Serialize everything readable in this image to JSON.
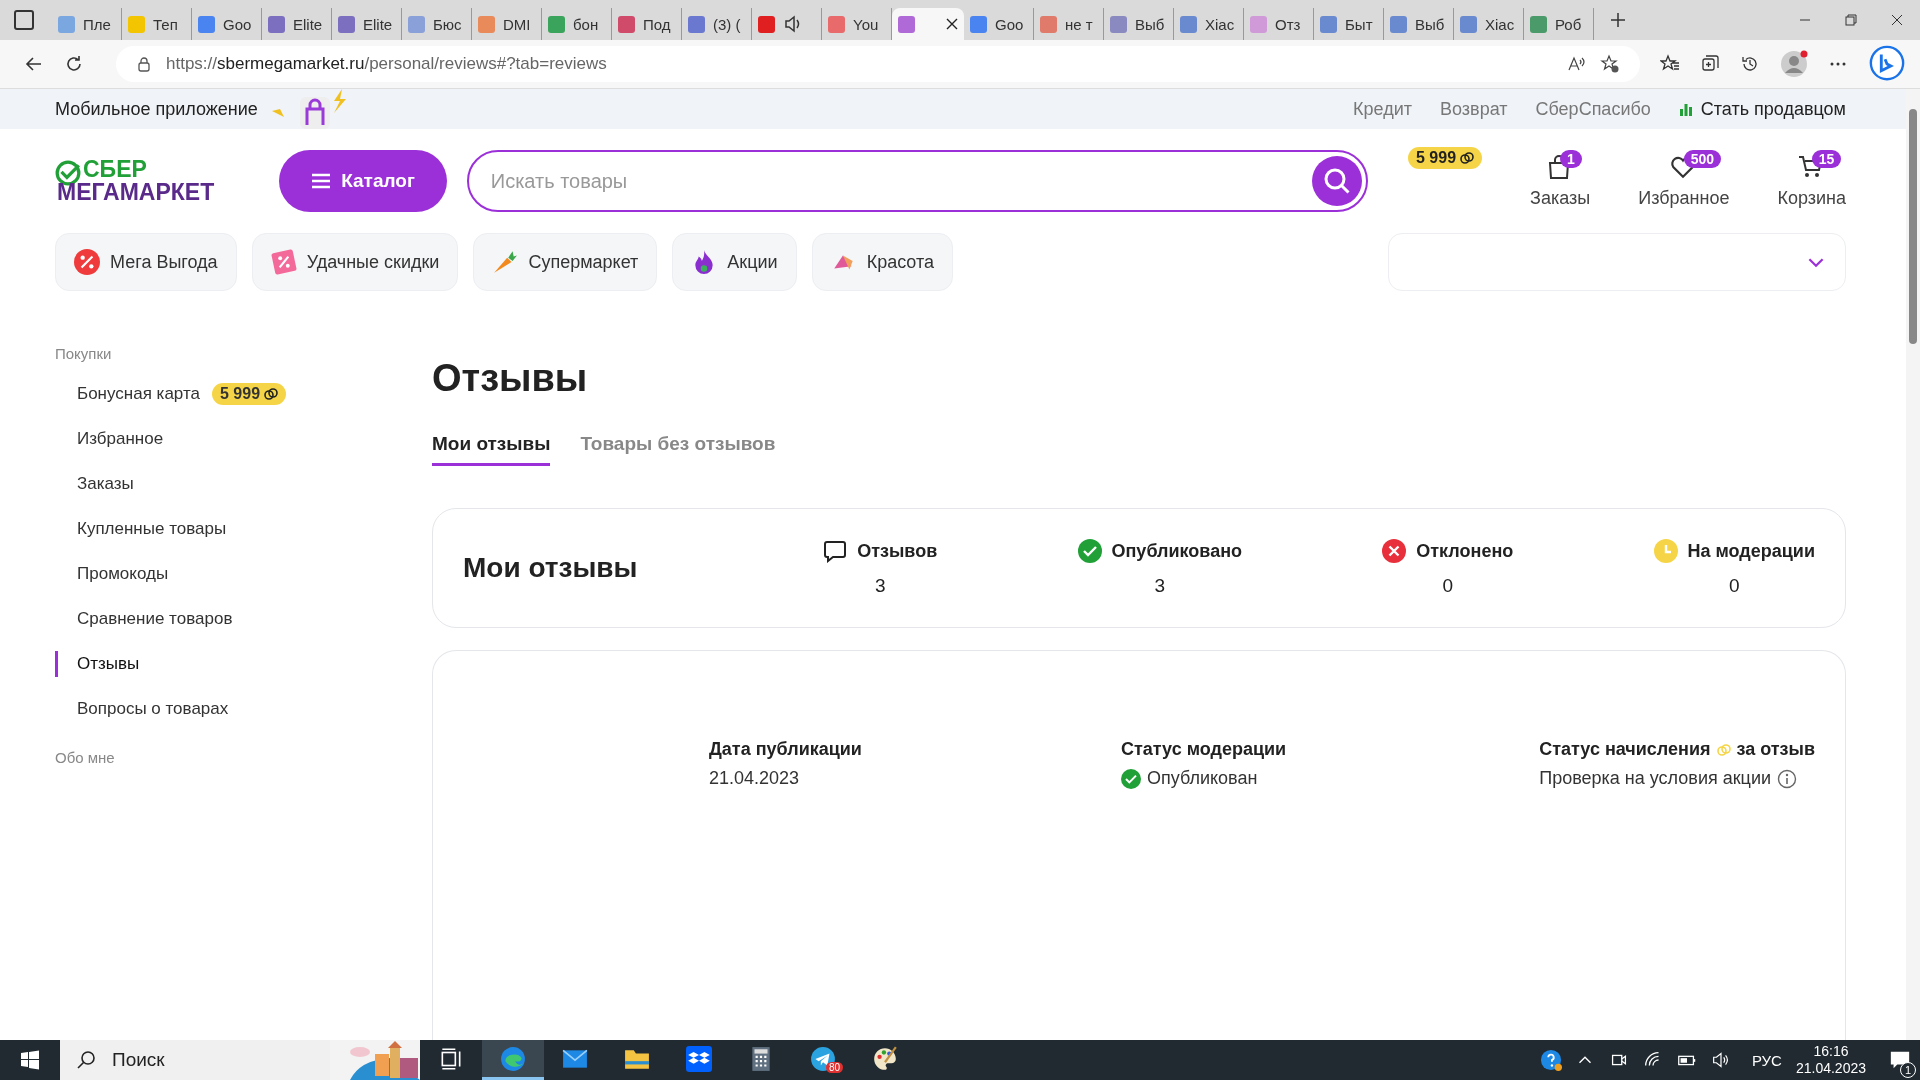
{
  "browser": {
    "tabs": [
      {
        "title": "Пле",
        "color": "#7aa7e0",
        "selected": false,
        "sound": false
      },
      {
        "title": "Теп",
        "color": "#f2c500",
        "selected": false,
        "sound": false
      },
      {
        "title": "Goo",
        "color": "#4a84f0",
        "selected": false,
        "sound": false
      },
      {
        "title": "Elite",
        "color": "#7d6fc0",
        "selected": false,
        "sound": false
      },
      {
        "title": "Elite",
        "color": "#7d6fc0",
        "selected": false,
        "sound": false
      },
      {
        "title": "Бюс",
        "color": "#8aa0d8",
        "selected": false,
        "sound": false
      },
      {
        "title": "DMI",
        "color": "#e88a5a",
        "selected": false,
        "sound": false
      },
      {
        "title": "бон",
        "color": "#3aa35c",
        "selected": false,
        "sound": false
      },
      {
        "title": "Под",
        "color": "#d04a6a",
        "selected": false,
        "sound": false
      },
      {
        "title": "(3) (",
        "color": "#6a78d0",
        "selected": false,
        "sound": false
      },
      {
        "color": "#e02020",
        "selected": false,
        "sound": true
      },
      {
        "title": "You",
        "color": "#e86a6a",
        "selected": false,
        "sound": false
      },
      {
        "color": "#b06ad8",
        "selected": true,
        "sound": false
      },
      {
        "title": "Goo",
        "color": "#4a84f0",
        "selected": false,
        "sound": false
      },
      {
        "title": "не т",
        "color": "#e07a6a",
        "selected": false,
        "sound": false
      },
      {
        "title": "Выб",
        "color": "#8a8ac0",
        "selected": false,
        "sound": false
      },
      {
        "title": "Xiac",
        "color": "#6a8ad0",
        "selected": false,
        "sound": false
      },
      {
        "title": "Отз",
        "color": "#d09ad8",
        "selected": false,
        "sound": false
      },
      {
        "title": "Быт",
        "color": "#6a8ad0",
        "selected": false,
        "sound": false
      },
      {
        "title": "Выб",
        "color": "#6a8ad0",
        "selected": false,
        "sound": false
      },
      {
        "title": "Xiac",
        "color": "#6a8ad0",
        "selected": false,
        "sound": false
      },
      {
        "title": "Роб",
        "color": "#4a9a6a",
        "selected": false,
        "sound": false
      }
    ],
    "url": {
      "scheme": "https://",
      "host": "sbermegamarket.ru",
      "path": "/personal/reviews#?tab=reviews"
    }
  },
  "top_bar": {
    "app_promo": "Мобильное приложение",
    "links": [
      "Кредит",
      "Возврат",
      "СберСпасибо"
    ],
    "seller_link": "Стать продавцом"
  },
  "header": {
    "logo_top": "СБЕР",
    "logo_bottom": "МЕГАМАРКЕТ",
    "catalog_button": "Каталог",
    "search": {
      "placeholder": "Искать товары"
    },
    "bonus": "5 999",
    "nav": [
      {
        "kind": "orders",
        "label": "Заказы",
        "count": "1"
      },
      {
        "kind": "favorites",
        "label": "Избранное",
        "count": "500"
      },
      {
        "kind": "cart",
        "label": "Корзина",
        "count": "15"
      }
    ]
  },
  "chips": [
    {
      "kind": "percent",
      "label": "Мега Выгода"
    },
    {
      "kind": "tag",
      "label": "Удачные скидки"
    },
    {
      "kind": "carrot",
      "label": "Супермаркет"
    },
    {
      "kind": "fire",
      "label": "Акции"
    },
    {
      "kind": "beauty",
      "label": "Красота"
    }
  ],
  "sidebar": {
    "sections": [
      {
        "title": "Покупки",
        "items": [
          {
            "label": "Бонусная карта",
            "badge": "5 999",
            "selected": false
          },
          {
            "label": "Избранное",
            "selected": false
          },
          {
            "label": "Заказы",
            "selected": false
          },
          {
            "label": "Купленные товары",
            "selected": false
          },
          {
            "label": "Промокоды",
            "selected": false
          },
          {
            "label": "Сравнение товаров",
            "selected": false
          },
          {
            "label": "Отзывы",
            "selected": true
          },
          {
            "label": "Вопросы о товарах",
            "selected": false
          }
        ]
      },
      {
        "title": "Обо мне"
      }
    ]
  },
  "main": {
    "title": "Отзывы",
    "tabs": [
      {
        "label": "Мои отзывы",
        "selected": true
      },
      {
        "label": "Товары без отзывов",
        "selected": false
      }
    ],
    "summary": {
      "title": "Мои отзывы",
      "stats": [
        {
          "kind": "total",
          "label": "Отзывов",
          "value": "3"
        },
        {
          "kind": "published",
          "label": "Опубликовано",
          "value": "3"
        },
        {
          "kind": "rejected",
          "label": "Отклонено",
          "value": "0"
        },
        {
          "kind": "moderation",
          "label": "На модерации",
          "value": "0"
        }
      ]
    },
    "review": {
      "date_label": "Дата публикации",
      "date": "21.04.2023",
      "status_label": "Статус модерации",
      "status": "Опубликован",
      "bonus_label_before": "Статус начисления",
      "bonus_label_after": "за отзыв",
      "bonus_status": "Проверка на условия акции"
    }
  },
  "taskbar": {
    "search": "Поиск",
    "apps": [
      {
        "kind": "taskview",
        "active": false
      },
      {
        "kind": "edge",
        "active": true
      },
      {
        "kind": "mail",
        "active": false
      },
      {
        "kind": "folder",
        "active": false
      },
      {
        "kind": "dropbox",
        "active": false
      },
      {
        "kind": "calculator",
        "active": false
      },
      {
        "kind": "telegram",
        "active": false,
        "badge": "80"
      },
      {
        "kind": "paint",
        "active": false
      }
    ],
    "language": "РУС",
    "time": "16:16",
    "date": "21.04.2023",
    "notifications": "1"
  }
}
